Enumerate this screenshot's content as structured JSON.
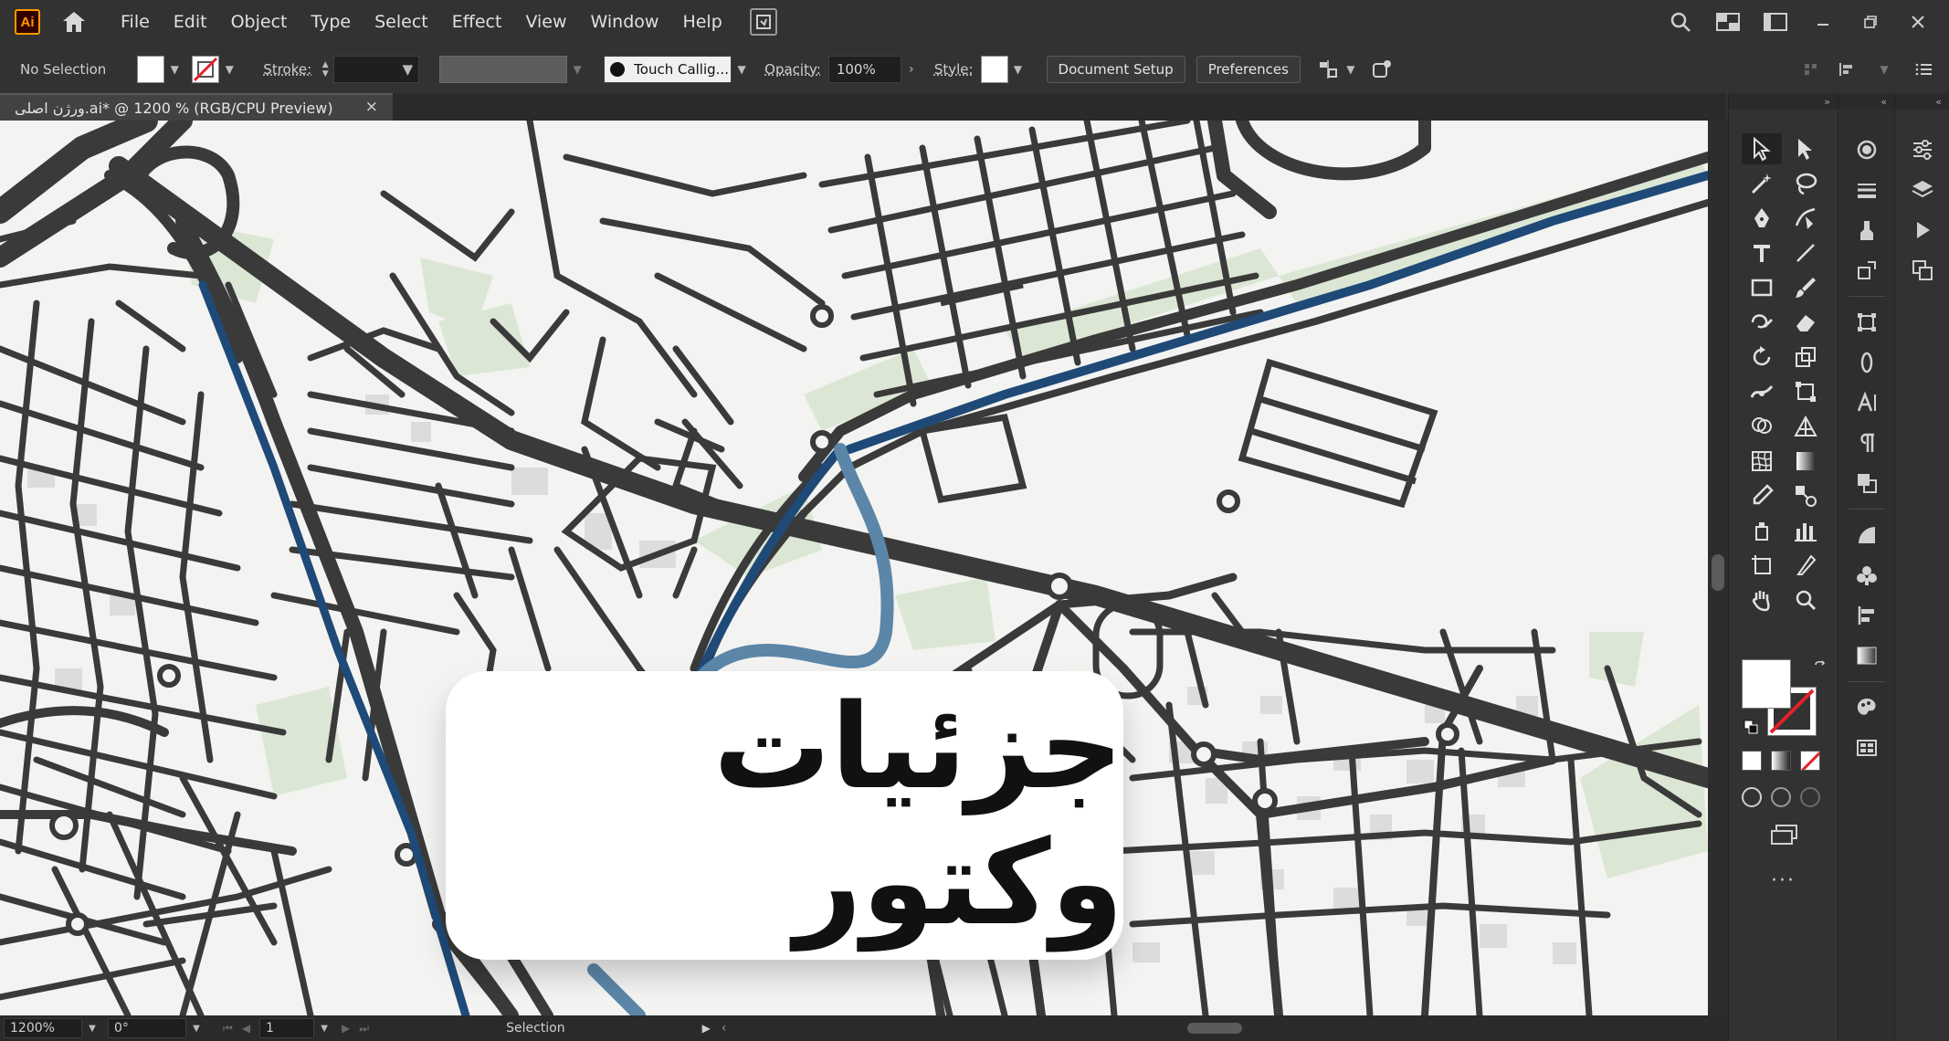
{
  "app": {
    "logo": "Ai",
    "menu": [
      "File",
      "Edit",
      "Object",
      "Type",
      "Select",
      "Effect",
      "View",
      "Window",
      "Help"
    ]
  },
  "control_bar": {
    "selection_label": "No Selection",
    "stroke_label": "Stroke:",
    "brush_name": "Touch Callig...",
    "opacity_label": "Opacity:",
    "opacity_value": "100%",
    "style_label": "Style:",
    "document_setup": "Document Setup",
    "preferences": "Preferences"
  },
  "document_tab": {
    "title": "ورژن اصلی.ai* @ 1200 % (RGB/CPU Preview)",
    "close": "×"
  },
  "overlay": {
    "text": "جزئیات وکتور"
  },
  "status_bar": {
    "zoom": "1200%",
    "rotation": "0°",
    "artboard": "1",
    "tool": "Selection"
  },
  "colors": {
    "road": "#3a3a3a",
    "river": "#1f4a78",
    "river_light": "#5b86a8",
    "park": "#d9e6d2",
    "canvas": "#f3f3f1",
    "building": "#d8d8d6"
  }
}
